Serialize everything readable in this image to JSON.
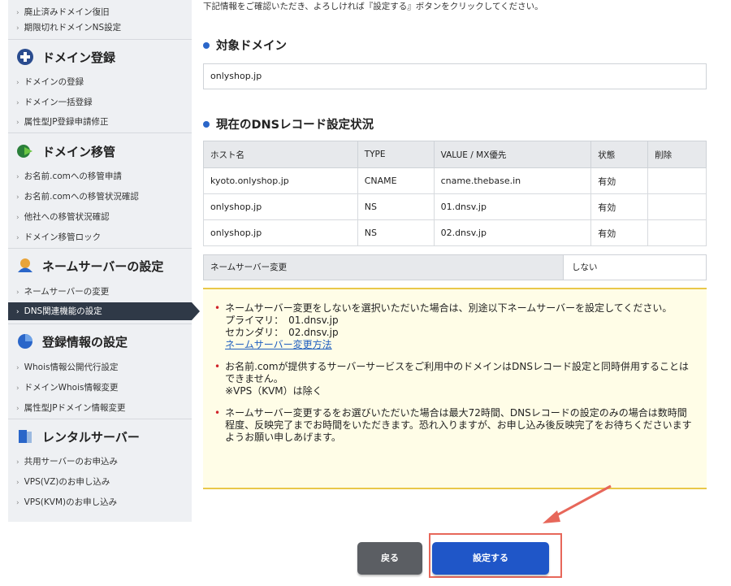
{
  "sidebar": {
    "top_items": [
      "廃止済みドメイン復旧",
      "期限切れドメインNS設定"
    ],
    "sections": [
      {
        "title": "ドメイン登録",
        "icon": "plus-circle-icon",
        "items": [
          "ドメインの登録",
          "ドメイン一括登録",
          "属性型JP登録申請修正"
        ]
      },
      {
        "title": "ドメイン移管",
        "icon": "transfer-arrow-icon",
        "items": [
          "お名前.comへの移管申請",
          "お名前.comへの移管状況確認",
          "他社への移管状況確認",
          "ドメイン移管ロック"
        ]
      },
      {
        "title": "ネームサーバーの設定",
        "icon": "nameserver-icon",
        "items": [
          "ネームサーバーの変更",
          "DNS関連機能の設定"
        ]
      },
      {
        "title": "登録情報の設定",
        "icon": "pie-chart-icon",
        "items": [
          "Whois情報公開代行設定",
          "ドメインWhois情報変更",
          "属性型JPドメイン情報変更"
        ]
      },
      {
        "title": "レンタルサーバー",
        "icon": "server-icon",
        "items": [
          "共用サーバーのお申込み",
          "VPS(VZ)のお申し込み",
          "VPS(KVM)のお申し込み"
        ]
      }
    ]
  },
  "main": {
    "intro": "下記情報をご確認いただき、よろしければ『設定する』ボタンをクリックしてください。",
    "target_title": "対象ドメイン",
    "domain": "onlyshop.jp",
    "records_title": "現在のDNSレコード設定状況",
    "table": {
      "headers": [
        "ホスト名",
        "TYPE",
        "VALUE / MX優先",
        "状態",
        "削除"
      ],
      "rows": [
        [
          "kyoto.onlyshop.jp",
          "CNAME",
          "cname.thebase.in",
          "有効",
          ""
        ],
        [
          "onlyshop.jp",
          "NS",
          "01.dnsv.jp",
          "有効",
          ""
        ],
        [
          "onlyshop.jp",
          "NS",
          "02.dnsv.jp",
          "有効",
          ""
        ]
      ]
    },
    "ns_change_label": "ネームサーバー変更",
    "ns_change_value": "しない",
    "notes": {
      "n1_text": "ネームサーバー変更をしないを選択いただいた場合は、別途以下ネームサーバーを設定してください。",
      "n1_primary": "プライマリ：　01.dnsv.jp",
      "n1_secondary": "セカンダリ：　02.dnsv.jp",
      "n1_link": "ネームサーバー変更方法",
      "n2_text": "お名前.comが提供するサーバーサービスをご利用中のドメインはDNSレコード設定と同時併用することはできません。",
      "n2_sub": "※VPS（KVM）は除く",
      "n3_text": "ネームサーバー変更するをお選びいただいた場合は最大72時間、DNSレコードの設定のみの場合は数時間程度、反映完了までお時間をいただきます。恐れ入りますが、お申し込み後反映完了をお待ちくださいますようお願い申しあげます。"
    },
    "buttons": {
      "back": "戻る",
      "submit": "設定する"
    }
  },
  "colors": {
    "accent_blue": "#1f56c8",
    "highlight_red": "#e7675a",
    "notice_bg": "#fffde7",
    "notice_border": "#e9c84a"
  }
}
